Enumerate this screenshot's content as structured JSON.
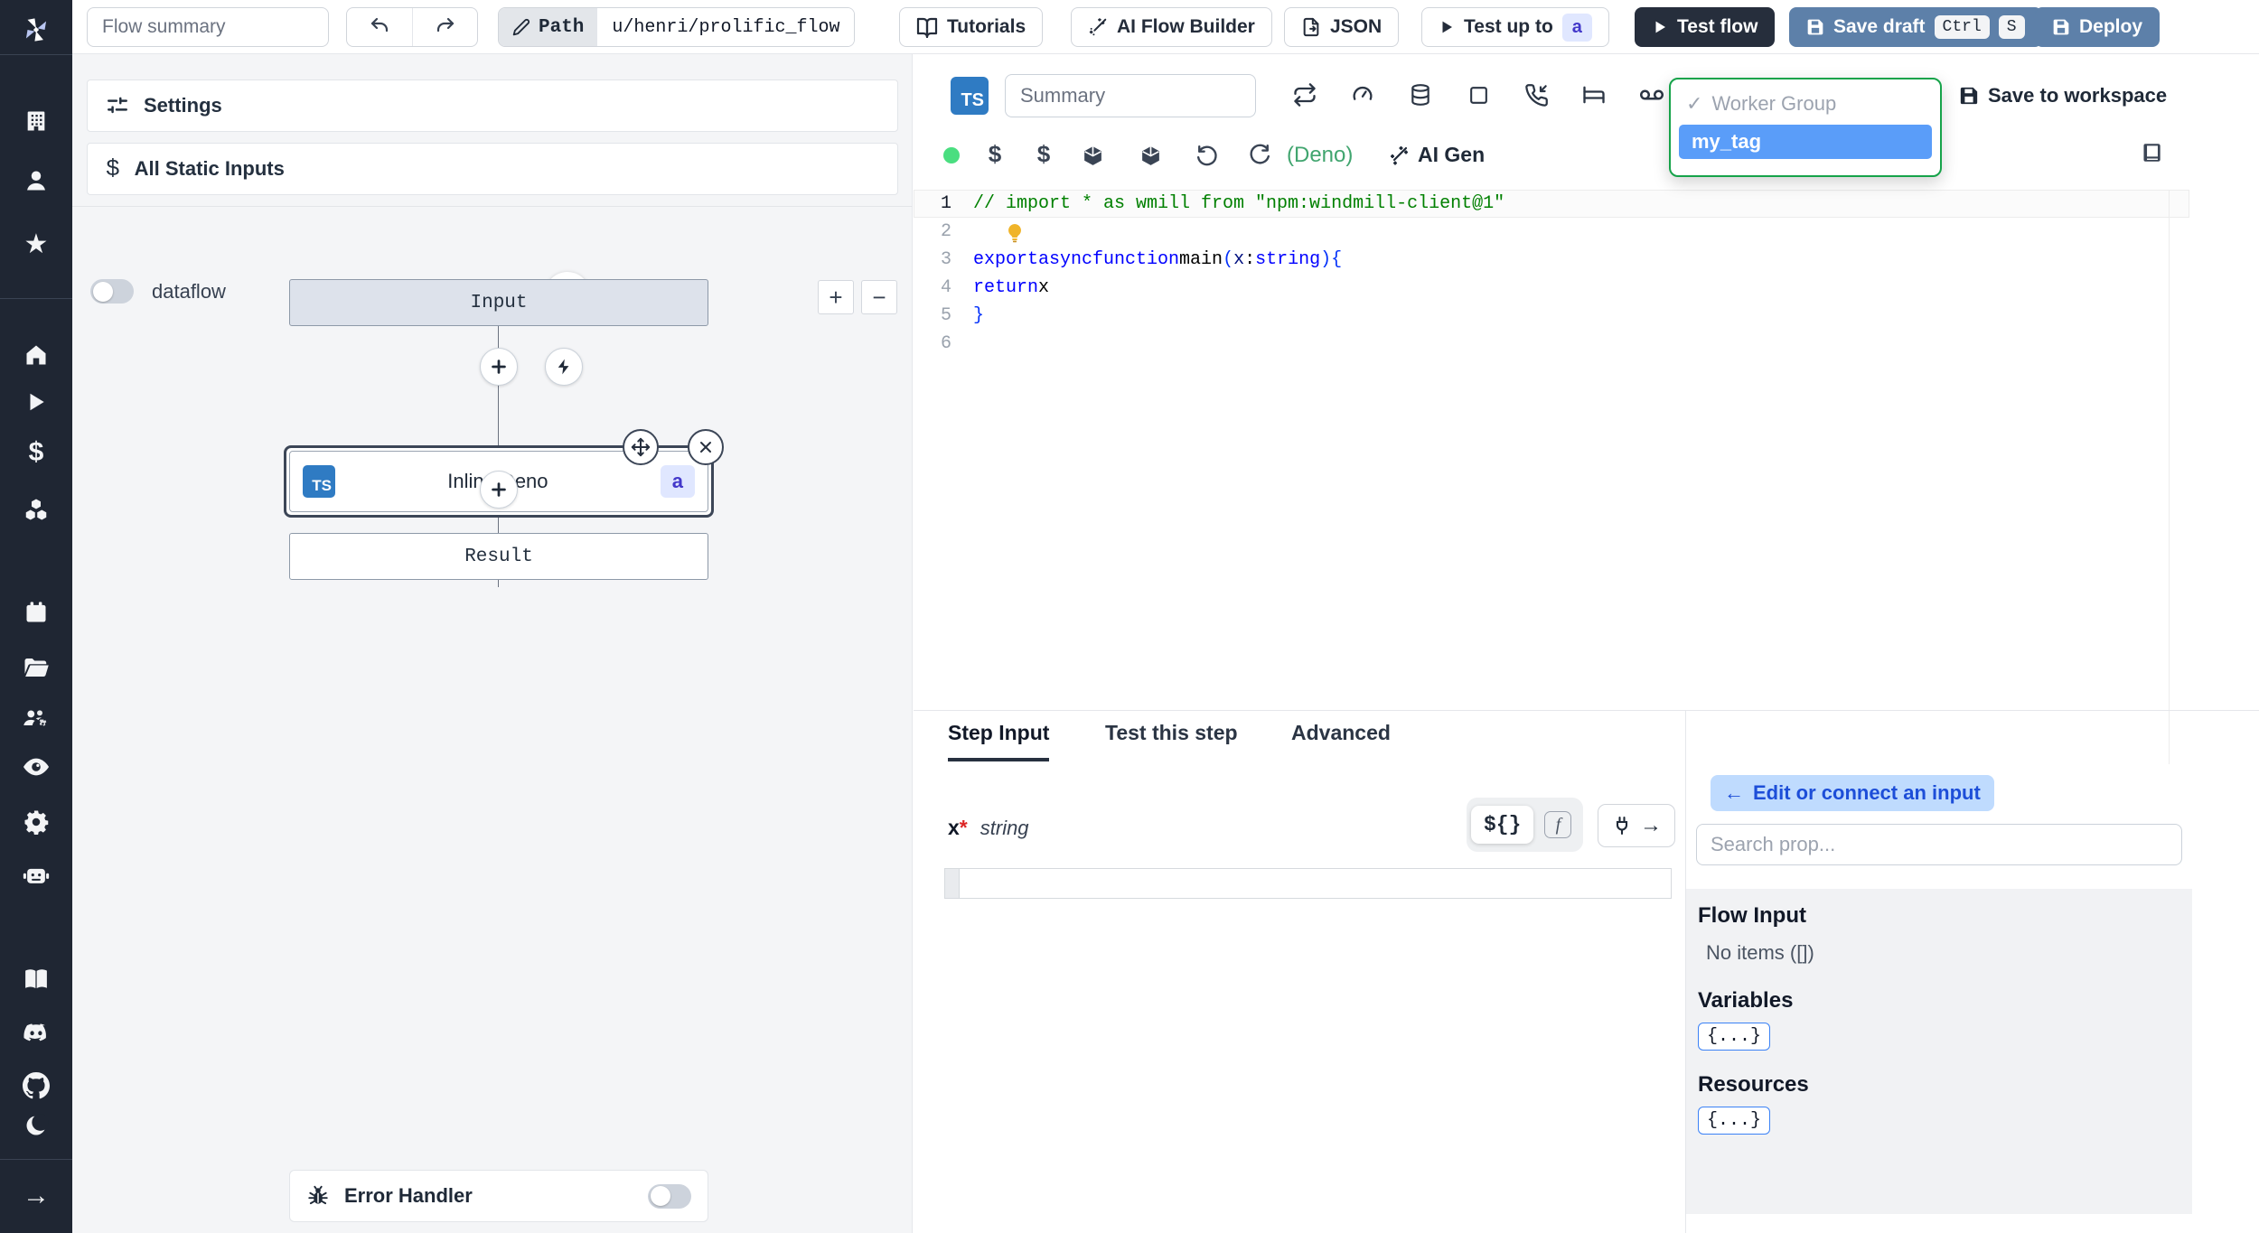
{
  "sidebar": {
    "icons": [
      "windmill-logo",
      "building",
      "user",
      "star",
      "home",
      "play",
      "dollar",
      "cubes",
      "calendar",
      "folder",
      "user-group-gear",
      "eye",
      "gear",
      "robot",
      "book",
      "discord",
      "github",
      "moon",
      "arrow-right"
    ]
  },
  "topbar": {
    "flow_summary_placeholder": "Flow summary",
    "path_label": "Path",
    "path_value": "u/henri/prolific_flow",
    "tutorials_label": "Tutorials",
    "ai_flow_builder_label": "AI Flow Builder",
    "json_label": "JSON",
    "test_up_to_label": "Test up to",
    "test_up_to_badge": "a",
    "test_flow_label": "Test flow",
    "save_draft_label": "Save draft",
    "kbd_ctrl": "Ctrl",
    "kbd_s": "S",
    "deploy_label": "Deploy"
  },
  "flow_panel": {
    "settings_label": "Settings",
    "all_static_inputs_label": "All Static Inputs",
    "dataflow_label": "dataflow",
    "zoom_in": "+",
    "zoom_out": "−",
    "input_node_label": "Input",
    "step_node_label": "Inline Deno",
    "step_node_badge": "a",
    "result_node_label": "Result",
    "error_handler_label": "Error Handler"
  },
  "editor": {
    "lang_badge": "TS",
    "summary_placeholder": "Summary",
    "runtime_label": "(Deno)",
    "ai_gen_label": "AI Gen",
    "save_to_workspace_label": "Save to workspace",
    "worker_group_check": "✓",
    "worker_group_option": "Worker Group",
    "selected_tag": "my_tag",
    "code": {
      "lines": [
        {
          "n": "1",
          "hl": true,
          "tokens": [
            {
              "t": "// import * as wmill from \"npm:windmill-client@1\"",
              "c": "cmt"
            }
          ]
        },
        {
          "n": "2",
          "tokens": []
        },
        {
          "n": "3",
          "tokens": [
            {
              "t": "export",
              "c": "kw"
            },
            {
              "t": " ",
              "c": "pl"
            },
            {
              "t": "async",
              "c": "kw"
            },
            {
              "t": " ",
              "c": "pl"
            },
            {
              "t": "function",
              "c": "kw"
            },
            {
              "t": " ",
              "c": "pl"
            },
            {
              "t": "main",
              "c": "pl"
            },
            {
              "t": "(",
              "c": "brk"
            },
            {
              "t": "x",
              "c": "prm"
            },
            {
              "t": ": ",
              "c": "pl"
            },
            {
              "t": "string",
              "c": "kw"
            },
            {
              "t": ")",
              "c": "brk"
            },
            {
              "t": " ",
              "c": "pl"
            },
            {
              "t": "{",
              "c": "brk"
            }
          ]
        },
        {
          "n": "4",
          "tokens": [
            {
              "t": "  ",
              "c": "pl"
            },
            {
              "t": "return",
              "c": "kw"
            },
            {
              "t": " x",
              "c": "pl"
            }
          ]
        },
        {
          "n": "5",
          "tokens": [
            {
              "t": "}",
              "c": "brk"
            }
          ]
        },
        {
          "n": "6",
          "tokens": []
        }
      ]
    }
  },
  "step_panel": {
    "tabs": [
      "Step Input",
      "Test this step",
      "Advanced"
    ],
    "field_name": "x",
    "required_star": "*",
    "field_type": "string",
    "expr_toggle_label": "${}",
    "fn_toggle_label": "f",
    "plug_arrow": "→"
  },
  "props_panel": {
    "edit_connect_arrow": "←",
    "edit_connect_label": "Edit or connect an input",
    "search_placeholder": "Search prop...",
    "flow_input_label": "Flow Input",
    "no_items_label": "No items ([])",
    "variables_label": "Variables",
    "resources_label": "Resources",
    "object_chip": "{...}"
  }
}
